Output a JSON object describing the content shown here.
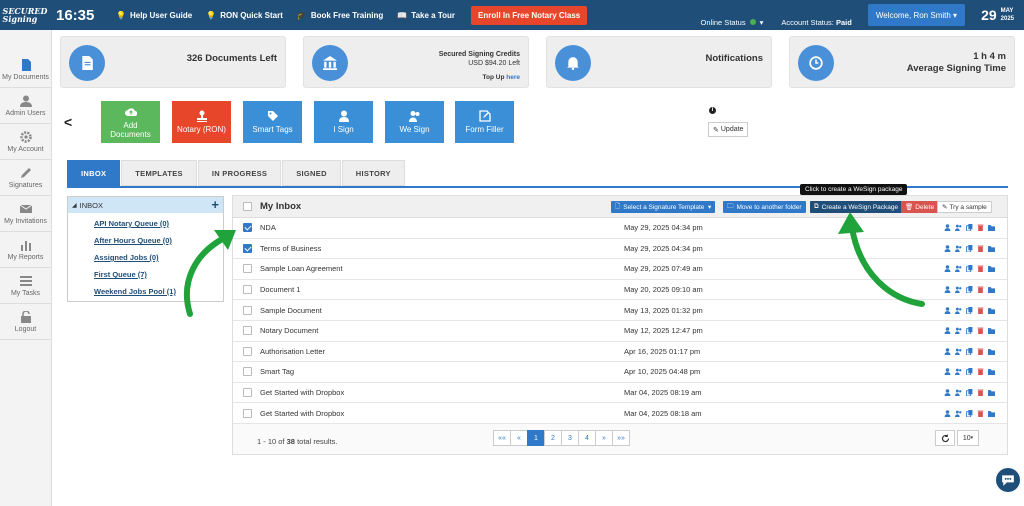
{
  "brand": {
    "logo_line1": "SECURED",
    "logo_line2": "Signing"
  },
  "topbar": {
    "clock": "16:35",
    "links": [
      "Help User Guide",
      "RON Quick Start",
      "Book Free Training",
      "Take a Tour"
    ],
    "enroll": "Enroll In Free Notary Class",
    "online_status": "Online Status",
    "account_status_label": "Account Status:",
    "account_status_value": "Paid",
    "welcome": "Welcome,  Ron Smith",
    "day": "29",
    "month": "MAY",
    "year": "2025"
  },
  "sidebar": [
    "My Documents",
    "Admin Users",
    "My Account",
    "Signatures",
    "My Invitations",
    "My Reports",
    "My Tasks",
    "Logout"
  ],
  "cards": {
    "documents": "326 Documents Left",
    "credits_title": "Secured Signing Credits",
    "credits_value": "USD $94.20 Left",
    "topup_text": "Top Up",
    "topup_link": "here",
    "notifications": "Notifications",
    "avg_time": "1 h 4 m",
    "avg_label": "Average Signing Time"
  },
  "tiles": {
    "add": "Add Documents",
    "notary": "Notary (RON)",
    "smart": "Smart Tags",
    "isign": "I Sign",
    "wesign": "We Sign",
    "form": "Form Filler"
  },
  "update_label": "Update",
  "tabs": [
    "INBOX",
    "TEMPLATES",
    "IN PROGRESS",
    "SIGNED",
    "HISTORY"
  ],
  "inbox_panel": {
    "title": "INBOX",
    "queues": [
      "API Notary Queue (0)",
      "After Hours Queue (0)",
      "Assigned Jobs (0)",
      "First Queue (7)",
      "Weekend Jobs Pool (1)"
    ]
  },
  "main": {
    "title": "My Inbox",
    "btn_template": "Select a Signature Template",
    "btn_move": "Move to another folder",
    "btn_wesign": "Create a WeSign Package",
    "btn_delete": "Delete",
    "btn_try": "Try a sample",
    "tooltip": "Click to create a WeSign package",
    "rows": [
      {
        "name": "NDA",
        "date": "May 29, 2025 04:34 pm",
        "checked": true
      },
      {
        "name": "Terms of Business",
        "date": "May 29, 2025 04:34 pm",
        "checked": true
      },
      {
        "name": "Sample Loan Agreement",
        "date": "May 29, 2025 07:49 am",
        "checked": false
      },
      {
        "name": "Document 1",
        "date": "May 20, 2025 09:10 am",
        "checked": false
      },
      {
        "name": "Sample Document",
        "date": "May 13, 2025 01:32 pm",
        "checked": false
      },
      {
        "name": "Notary Document",
        "date": "May 12, 2025 12:47 pm",
        "checked": false
      },
      {
        "name": "Authorisation Letter",
        "date": "Apr 16, 2025 01:17 pm",
        "checked": false
      },
      {
        "name": "Smart Tag",
        "date": "Apr 10, 2025 04:48 pm",
        "checked": false
      },
      {
        "name": "Get Started with Dropbox",
        "date": "Mar 04, 2025 08:19 am",
        "checked": false
      },
      {
        "name": "Get Started with Dropbox",
        "date": "Mar 04, 2025 08:18 am",
        "checked": false
      }
    ],
    "footer_prefix": "1 - 10 of",
    "footer_total": "38",
    "footer_suffix": "total results.",
    "pages": [
      "««",
      "«",
      "1",
      "2",
      "3",
      "4",
      "»",
      "»»"
    ],
    "per_page": "10"
  },
  "colors": {
    "navy": "#1f4e79",
    "blue": "#2f79c8",
    "green": "#4caf50",
    "orange": "#e8462b",
    "arrow": "#1fa33a"
  }
}
